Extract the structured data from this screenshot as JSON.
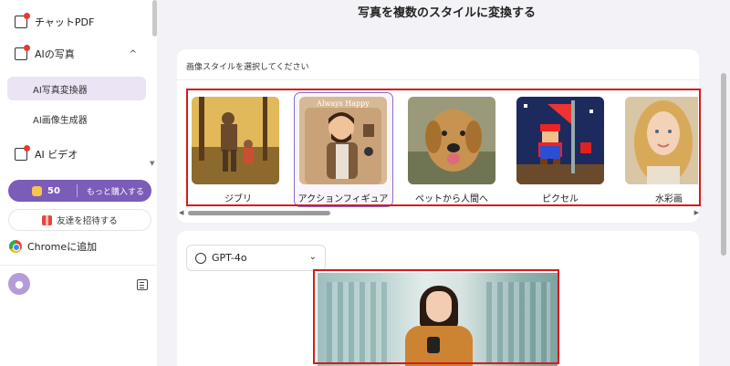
{
  "page_title": "写真を複数のスタイルに変換する",
  "sidebar": {
    "chat_pdf": "チャットPDF",
    "ai_photo": "AIの写真",
    "ai_photo_chevron": "^",
    "sub_items": [
      {
        "label": "AI写真変換器",
        "active": true
      },
      {
        "label": "AI画像生成器",
        "active": false
      }
    ],
    "ai_video": "AI ビデオ",
    "credits": {
      "count": "50",
      "buy_label": "もっと購入する"
    },
    "invite_label": "友達を招待する",
    "chrome_label": "Chromeに追加"
  },
  "style_section": {
    "heading": "画像スタイルを選択してください",
    "styles": [
      {
        "label": "ジブリ",
        "selected": false
      },
      {
        "label": "アクションフィギュア",
        "selected": true,
        "badge": "Always Happy"
      },
      {
        "label": "ペットから人間へ",
        "selected": false
      },
      {
        "label": "ピクセル",
        "selected": false
      },
      {
        "label": "水彩画",
        "selected": false
      }
    ]
  },
  "model": {
    "selected": "GPT-4o"
  },
  "colors": {
    "accent": "#7b5cb8",
    "highlight_box": "#d7191c"
  }
}
